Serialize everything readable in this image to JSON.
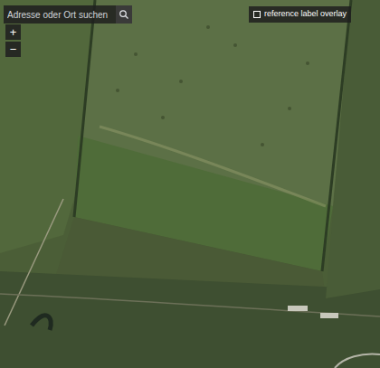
{
  "search": {
    "placeholder": "Adresse oder Ort suchen",
    "button": "search"
  },
  "zoom": [
    {
      "label": "+",
      "action": "zoom-in"
    },
    {
      "label": "−",
      "action": "zoom-out"
    }
  ],
  "overlay_toggle": {
    "label": "reference label overlay",
    "checked": false
  },
  "map": {
    "kind": "satellite"
  }
}
